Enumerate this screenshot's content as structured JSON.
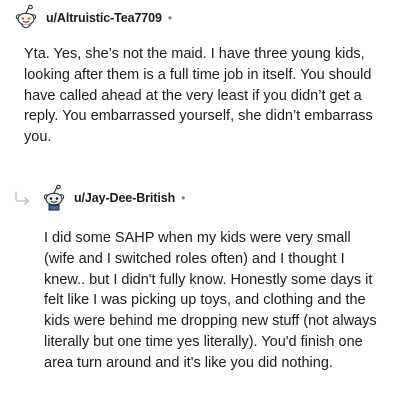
{
  "comments": [
    {
      "username": "u/Altruistic-Tea7709",
      "separator": "•",
      "avatar_icon": "reddit-snoo-avatar-icon",
      "body": "Yta. Yes, she’s not the maid. I have three young kids, looking after them is a full time job in itself. You should have called ahead at the very least if you didn’t get a reply. You embarrassed yourself, she didn’t embarrass you."
    },
    {
      "username": "u/Jay-Dee-British",
      "separator": "•",
      "avatar_icon": "reddit-snoo-avatar-icon",
      "reply_icon": "reply-arrow-icon",
      "body": "I did some SAHP when my kids were very small (wife and I switched roles often) and I thought I knew.. but I didn't fully know. Honestly some days it felt like I was picking up toys, and clothing and the kids were behind me dropping new stuff (not always literally but one time yes literally). You'd finish one area turn around and it's like you did nothing."
    }
  ],
  "colors": {
    "text": "#1c1c1c",
    "muted": "#7c7c7c",
    "reply_arrow": "#c7c7c7",
    "avatar_outline": "#9ba7b3"
  }
}
